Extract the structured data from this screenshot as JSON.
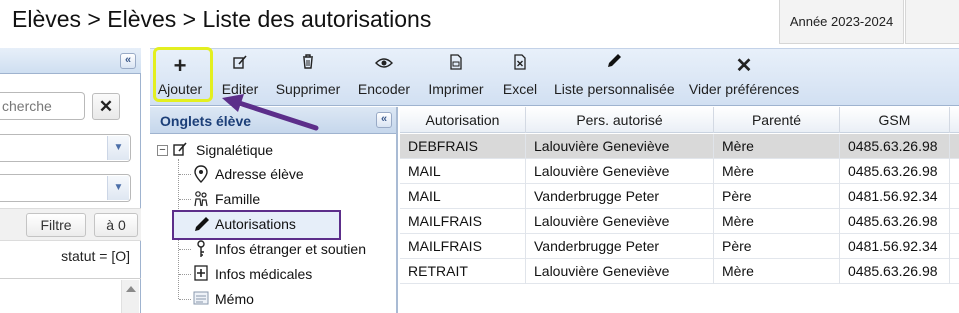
{
  "header": {
    "breadcrumb": "Elèves > Elèves > Liste des autorisations",
    "year_tab": "Année 2023-2024"
  },
  "filters": {
    "search_placeholder": "cherche",
    "search_value": "cherche",
    "clear_label": "✕",
    "filtre_label": "Filtre",
    "a_zero_label": "à 0",
    "status_text": "statut = [O]"
  },
  "toolbar": {
    "buttons": [
      {
        "label": "Ajouter",
        "icon": "plus-icon"
      },
      {
        "label": "Editer",
        "icon": "edit-icon"
      },
      {
        "label": "Supprimer",
        "icon": "trash-icon"
      },
      {
        "label": "Encoder",
        "icon": "eye-icon"
      },
      {
        "label": "Imprimer",
        "icon": "print-icon"
      },
      {
        "label": "Excel",
        "icon": "excel-icon"
      },
      {
        "label": "Liste personnalisée",
        "icon": "pencil-icon"
      },
      {
        "label": "Vider préférences",
        "icon": "x-icon"
      }
    ]
  },
  "onglets": {
    "title": "Onglets élève",
    "root_label": "Signalétique",
    "items": [
      {
        "label": "Adresse élève"
      },
      {
        "label": "Famille"
      },
      {
        "label": "Autorisations"
      },
      {
        "label": "Infos étranger et soutien"
      },
      {
        "label": "Infos médicales"
      },
      {
        "label": "Mémo"
      }
    ]
  },
  "grid": {
    "columns": [
      "Autorisation",
      "Pers. autorisé",
      "Parenté",
      "GSM"
    ],
    "rows": [
      {
        "autorisation": "DEBFRAIS",
        "personne": "Lalouvière Geneviève",
        "parente": "Mère",
        "gsm": "0485.63.26.98"
      },
      {
        "autorisation": "MAIL",
        "personne": "Lalouvière Geneviève",
        "parente": "Mère",
        "gsm": "0485.63.26.98"
      },
      {
        "autorisation": "MAIL",
        "personne": "Vanderbrugge Peter",
        "parente": "Père",
        "gsm": "0481.56.92.34"
      },
      {
        "autorisation": "MAILFRAIS",
        "personne": "Lalouvière Geneviève",
        "parente": "Mère",
        "gsm": "0485.63.26.98"
      },
      {
        "autorisation": "MAILFRAIS",
        "personne": "Vanderbrugge Peter",
        "parente": "Père",
        "gsm": "0481.56.92.34"
      },
      {
        "autorisation": "RETRAIT",
        "personne": "Lalouvière Geneviève",
        "parente": "Mère",
        "gsm": "0485.63.26.98"
      }
    ]
  },
  "colors": {
    "highlight_yellow": "#e3ef20",
    "highlight_purple": "#5c2e8a",
    "panel_blue": "#d2e0f2",
    "header_blue_text": "#1c3f78"
  }
}
